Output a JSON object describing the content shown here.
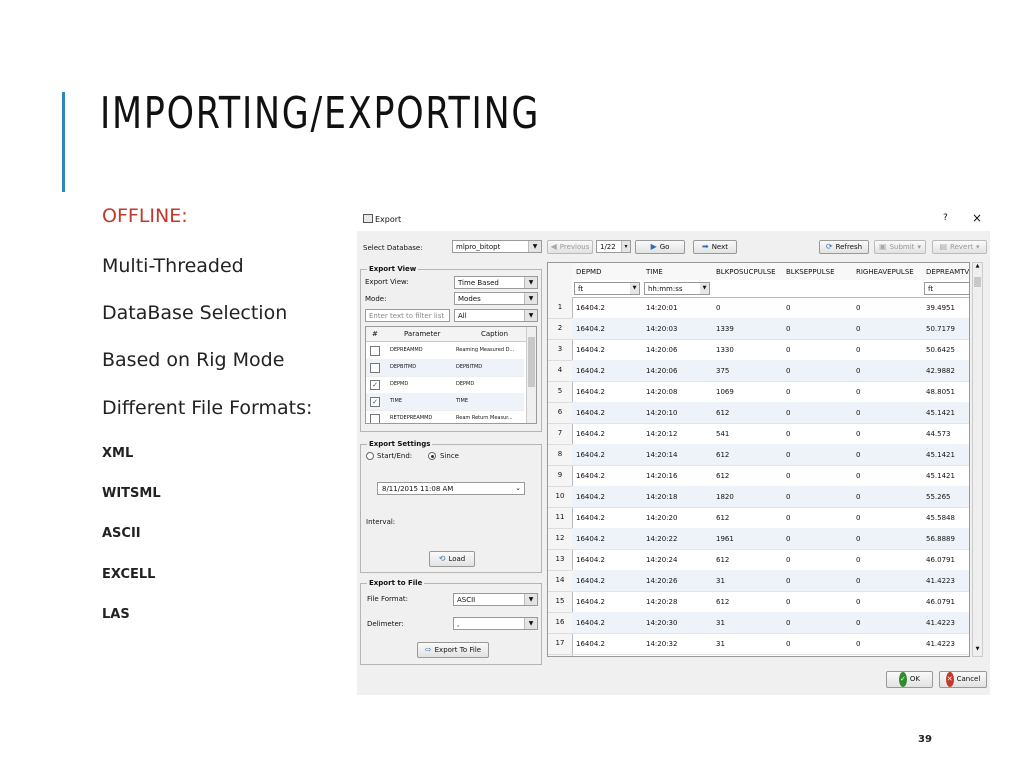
{
  "slide": {
    "title": "IMPORTING/EXPORTING",
    "page_number": "39",
    "bullets": {
      "heading": "OFFLINE:",
      "items": [
        "Multi-Threaded",
        "DataBase Selection",
        "Based on Rig Mode",
        "Different File Formats:"
      ],
      "formats": [
        "XML",
        "WITSML",
        "ASCII",
        "EXCELL",
        "LAS"
      ]
    },
    "accent_color": "#2e88b8",
    "heading_color": "#c0392b"
  },
  "dialog": {
    "title": "Export",
    "help": "?",
    "close": "×",
    "select_database_label": "Select Database:",
    "database_value": "mlpro_bitopt",
    "nav": {
      "previous": "Previous",
      "page": "1/22",
      "go": "Go",
      "next": "Next"
    },
    "toolbar": {
      "refresh": "Refresh",
      "submit": "Submit",
      "revert": "Revert"
    },
    "export_view": {
      "title": "Export View",
      "export_view_label": "Export View:",
      "export_view_value": "Time Based",
      "mode_label": "Mode:",
      "mode_value": "Modes",
      "filter_placeholder": "Enter text to filter list",
      "filter_scope": "All",
      "columns": [
        "#",
        "Parameter",
        "Caption"
      ],
      "rows": [
        {
          "checked": false,
          "parameter": "DEPREAMMD",
          "caption": "Reaming Measured D..."
        },
        {
          "checked": false,
          "parameter": "DEPBITMD",
          "caption": "DEPBITMD"
        },
        {
          "checked": true,
          "parameter": "DEPMD",
          "caption": "DEPMD"
        },
        {
          "checked": true,
          "parameter": "TIME",
          "caption": "TIME"
        },
        {
          "checked": false,
          "parameter": "RETDEPREAMMD",
          "caption": "Ream Return Measur..."
        }
      ]
    },
    "export_settings": {
      "title": "Export Settings",
      "start_end_label": "Start/End:",
      "since_label": "Since",
      "since_selected": true,
      "datetime": "8/11/2015 11:08 AM",
      "interval_label": "Interval:",
      "load": "Load"
    },
    "export_to_file": {
      "title": "Export to File",
      "file_format_label": "File Format:",
      "file_format_value": "ASCII",
      "delimeter_label": "Delimeter:",
      "delimeter_value": ",",
      "export_button": "Export To File"
    },
    "grid": {
      "columns": [
        "DEPMD",
        "TIME",
        "BLKPOSUCPULSE",
        "BLKSEPPULSE",
        "RIGHEAVEPULSE",
        "DEPREAMTVD"
      ],
      "units": [
        "ft",
        "hh:mm:ss",
        "",
        "",
        "",
        "ft"
      ],
      "rows": [
        {
          "n": "1",
          "cells": [
            "16404.2",
            "14:20:01",
            "0",
            "0",
            "0",
            "39.4951"
          ]
        },
        {
          "n": "2",
          "cells": [
            "16404.2",
            "14:20:03",
            "1339",
            "0",
            "0",
            "50.7179"
          ]
        },
        {
          "n": "3",
          "cells": [
            "16404.2",
            "14:20:06",
            "1330",
            "0",
            "0",
            "50.6425"
          ]
        },
        {
          "n": "4",
          "cells": [
            "16404.2",
            "14:20:06",
            "375",
            "0",
            "0",
            "42.9882"
          ]
        },
        {
          "n": "5",
          "cells": [
            "16404.2",
            "14:20:08",
            "1069",
            "0",
            "0",
            "48.8051"
          ]
        },
        {
          "n": "6",
          "cells": [
            "16404.2",
            "14:20:10",
            "612",
            "0",
            "0",
            "45.1421"
          ]
        },
        {
          "n": "7",
          "cells": [
            "16404.2",
            "14:20:12",
            "541",
            "0",
            "0",
            "44.573"
          ]
        },
        {
          "n": "8",
          "cells": [
            "16404.2",
            "14:20:14",
            "612",
            "0",
            "0",
            "45.1421"
          ]
        },
        {
          "n": "9",
          "cells": [
            "16404.2",
            "14:20:16",
            "612",
            "0",
            "0",
            "45.1421"
          ]
        },
        {
          "n": "10",
          "cells": [
            "16404.2",
            "14:20:18",
            "1820",
            "0",
            "0",
            "55.265"
          ]
        },
        {
          "n": "11",
          "cells": [
            "16404.2",
            "14:20:20",
            "612",
            "0",
            "0",
            "45.5848"
          ]
        },
        {
          "n": "12",
          "cells": [
            "16404.2",
            "14:20:22",
            "1961",
            "0",
            "0",
            "56.8889"
          ]
        },
        {
          "n": "13",
          "cells": [
            "16404.2",
            "14:20:24",
            "612",
            "0",
            "0",
            "46.0791"
          ]
        },
        {
          "n": "14",
          "cells": [
            "16404.2",
            "14:20:26",
            "31",
            "0",
            "0",
            "41.4223"
          ]
        },
        {
          "n": "15",
          "cells": [
            "16404.2",
            "14:20:28",
            "612",
            "0",
            "0",
            "46.0791"
          ]
        },
        {
          "n": "16",
          "cells": [
            "16404.2",
            "14:20:30",
            "31",
            "0",
            "0",
            "41.4223"
          ]
        },
        {
          "n": "17",
          "cells": [
            "16404.2",
            "14:20:32",
            "31",
            "0",
            "0",
            "41.4223"
          ]
        }
      ]
    },
    "ok": "OK",
    "cancel": "Cancel"
  }
}
